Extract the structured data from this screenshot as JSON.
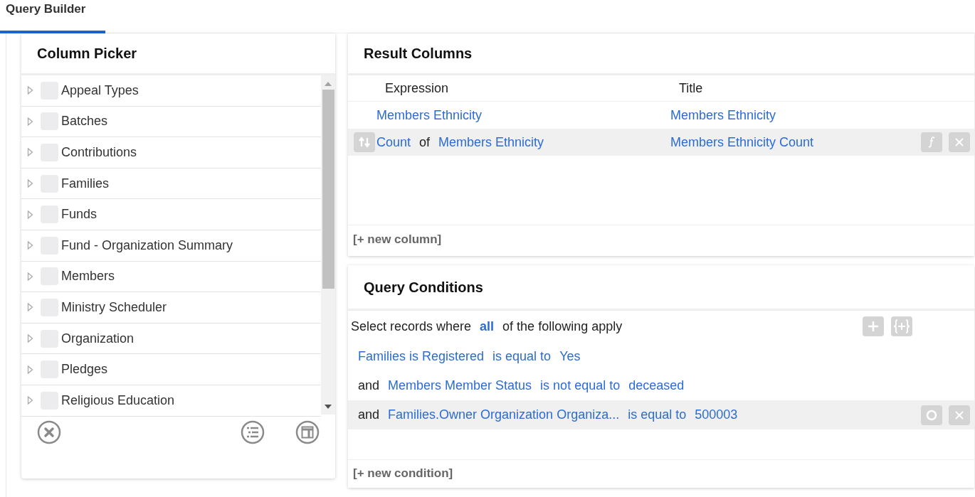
{
  "tabs": [
    {
      "label": "Query Builder",
      "selected": true
    }
  ],
  "column_picker": {
    "title": "Column Picker",
    "items": [
      {
        "label": "Appeal Types",
        "expanded": false,
        "checked": false
      },
      {
        "label": "Batches",
        "expanded": false,
        "checked": false
      },
      {
        "label": "Contributions",
        "expanded": false,
        "checked": false
      },
      {
        "label": "Families",
        "expanded": false,
        "checked": false
      },
      {
        "label": "Funds",
        "expanded": false,
        "checked": false
      },
      {
        "label": "Fund - Organization Summary",
        "expanded": false,
        "checked": false
      },
      {
        "label": "Members",
        "expanded": false,
        "checked": false
      },
      {
        "label": "Ministry Scheduler",
        "expanded": false,
        "checked": false
      },
      {
        "label": "Organization",
        "expanded": false,
        "checked": false
      },
      {
        "label": "Pledges",
        "expanded": false,
        "checked": false
      },
      {
        "label": "Religious Education",
        "expanded": false,
        "checked": false
      }
    ]
  },
  "result_columns": {
    "title": "Result Columns",
    "columns": [
      "Expression",
      "Title"
    ],
    "rows": [
      {
        "expression": "Members Ethnicity",
        "title": "Members Ethnicity",
        "selected": false
      },
      {
        "aggregate": "Count",
        "of": "of",
        "expression": "Members Ethnicity",
        "title": "Members Ethnicity Count",
        "selected": true
      }
    ],
    "new_link": "[+ new column]"
  },
  "query_conditions": {
    "title": "Query Conditions",
    "lead": "Select records where",
    "quantifier": "all",
    "trail": "of the following apply",
    "conditions": [
      {
        "field": "Families is Registered",
        "operator": "is equal to",
        "value": "Yes",
        "selected": false
      },
      {
        "conjunction": "and",
        "field": "Members Member Status",
        "operator": "is not equal to",
        "value": "deceased",
        "selected": false
      },
      {
        "conjunction": "and",
        "field": "Families.Owner Organization Organiza...",
        "operator": "is equal to",
        "value": "500003",
        "selected": true
      }
    ],
    "new_link": "[+ new condition]"
  }
}
